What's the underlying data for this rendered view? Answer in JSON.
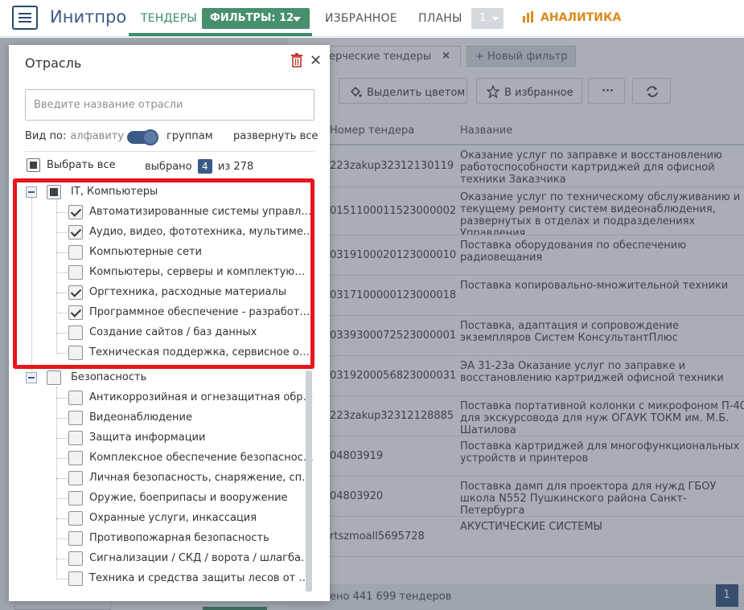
{
  "nav": {
    "brand": "Инитпро",
    "tenders": "ТЕНДЕРЫ",
    "filters": "ФИЛЬТРЫ: 12",
    "favorites": "ИЗБРАННОЕ",
    "plans": "ПЛАНЫ",
    "plans_value": "1",
    "analytics": "АНАЛИТИКА"
  },
  "results": {
    "tab_active": "ерческие тендеры",
    "tab_new": "+ Новый фильтр",
    "btn_color": "Выделить цветом",
    "btn_fav": "В избранное",
    "btn_more": "···",
    "col_number": "Номер тендера",
    "col_name": "Название",
    "rows": [
      {
        "num": "223zakup32312130119",
        "name": "Оказание услуг по заправке и восстановлению работоспособности картриджей для офисной техники Заказчика",
        "h": 52
      },
      {
        "num": "0151100011523000002",
        "name": "Оказание услуг по техническому обслуживанию и текущему ремонту систем видеонаблюдения, развернутых в отделах и подразделениях Управления",
        "h": 60
      },
      {
        "num": "0319100020123000010",
        "name": "Поставка оборудования по обеспечению радиовещания",
        "h": 50
      },
      {
        "num": "0317100000123000018",
        "name": "Поставка копировально-множительной техники",
        "h": 50
      },
      {
        "num": "0339300072523000001",
        "name": "Поставка, адаптация и сопровождение экземпляров Систем КонсультантПлюс",
        "h": 50
      },
      {
        "num": "0319200056823000031",
        "name": "ЭА 31-23а Оказание услуг по заправке и восстановлению картриджей офисной техники",
        "h": 50
      },
      {
        "num": "223zakup32312128885",
        "name": "Поставка портативной колонки с микрофоном П-40 для экскурсовода для нуж ОГАУК ТОКМ им. М.Б. Шатилова",
        "h": 50
      },
      {
        "num": "04803919",
        "name": "Поставка картриджей для многофункциональных устройств и принтеров",
        "h": 50
      },
      {
        "num": "04803920",
        "name": "Поставка дамп для проектора для нужд ГБОУ школа N552 Пушкинского района Санкт-Петербурга",
        "h": 50
      },
      {
        "num": "rtszmoall5695728",
        "name": "АКУСТИЧЕСКИЕ СИСТЕМЫ",
        "h": 50
      }
    ],
    "footer": "ено 441 699 тендеров",
    "page": "1"
  },
  "panel": {
    "title": "Отрасль",
    "search_placeholder": "Введите название отрасли",
    "view_by": "Вид по:",
    "alphabet": "алфавиту",
    "groups": "группам",
    "expand_all": "развернуть все",
    "select_all": "Выбрать все",
    "selected_prefix": "выбрано",
    "selected_count": "4",
    "selected_suffix": "из 278",
    "groups_list": [
      {
        "label": "IT, Компьютеры",
        "state": "partial",
        "items": [
          {
            "label": "Автоматизированные системы управления",
            "checked": true
          },
          {
            "label": "Аудио, видео, фототехника, мультимедиа",
            "checked": true
          },
          {
            "label": "Компьютерные сети",
            "checked": false
          },
          {
            "label": "Компьютеры, серверы и комплектующие",
            "checked": false
          },
          {
            "label": "Оргтехника, расходные материалы",
            "checked": true
          },
          {
            "label": "Программное обеспечение - разработка и поставка",
            "checked": true
          },
          {
            "label": "Создание сайтов / баз данных",
            "checked": false
          },
          {
            "label": "Техническая поддержка, сервисное обслуживание",
            "checked": false
          }
        ]
      },
      {
        "label": "Безопасность",
        "state": "none",
        "items": [
          {
            "label": "Антикоррозийная и огнезащитная обработка",
            "checked": false
          },
          {
            "label": "Видеонаблюдение",
            "checked": false
          },
          {
            "label": "Защита информации",
            "checked": false
          },
          {
            "label": "Комплексное обеспечение безопасности",
            "checked": false
          },
          {
            "label": "Личная безопасность, снаряжение, спецодежда",
            "checked": false
          },
          {
            "label": "Оружие, боеприпасы и вооружение",
            "checked": false
          },
          {
            "label": "Охранные услуги, инкассация",
            "checked": false
          },
          {
            "label": "Противопожарная безопасность",
            "checked": false
          },
          {
            "label": "Сигнализации / СКД / ворота / шлагбаумы",
            "checked": false
          },
          {
            "label": "Техника и средства защиты лесов от пожаров",
            "checked": false
          }
        ]
      }
    ]
  }
}
